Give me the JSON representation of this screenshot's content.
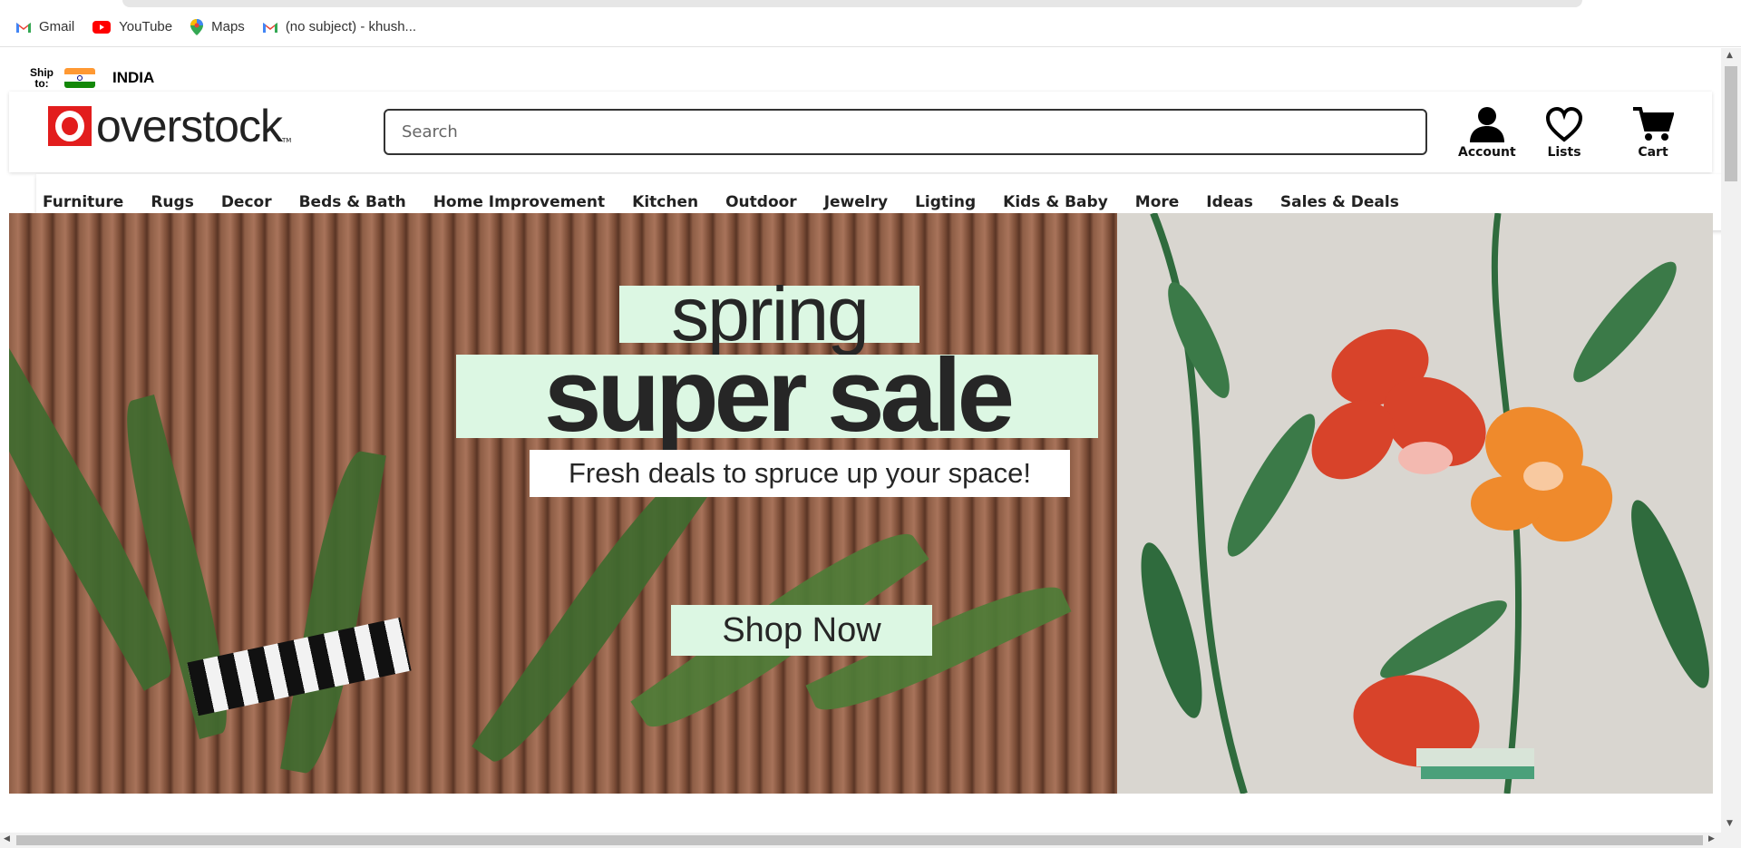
{
  "bookmarks": [
    {
      "label": "Gmail",
      "icon": "gmail-icon"
    },
    {
      "label": "YouTube",
      "icon": "youtube-icon"
    },
    {
      "label": "Maps",
      "icon": "maps-icon"
    },
    {
      "label": "(no subject) - khush...",
      "icon": "gmail-icon"
    }
  ],
  "ship": {
    "label_line1": "Ship",
    "label_line2": "to:",
    "country": "INDIA"
  },
  "logo": {
    "text": "overstock",
    "tm": "TM",
    "color": "#e21d1d"
  },
  "search": {
    "placeholder": "Search",
    "value": ""
  },
  "header_icons": {
    "account_label": "Account",
    "lists_label": "Lists",
    "cart_label": "Cart"
  },
  "nav": {
    "items": [
      "Furniture",
      "Rugs",
      "Decor",
      "Beds & Bath",
      "Home Improvement",
      "Kitchen",
      "Outdoor",
      "Jewelry",
      "Ligting",
      "Kids & Baby",
      "More",
      "Ideas",
      "Sales & Deals"
    ]
  },
  "hero": {
    "line1": "spring",
    "line2": "super sale",
    "tagline": "Fresh deals to spruce up your space!",
    "cta": "Shop Now",
    "accent_color": "#dcf7e3"
  }
}
